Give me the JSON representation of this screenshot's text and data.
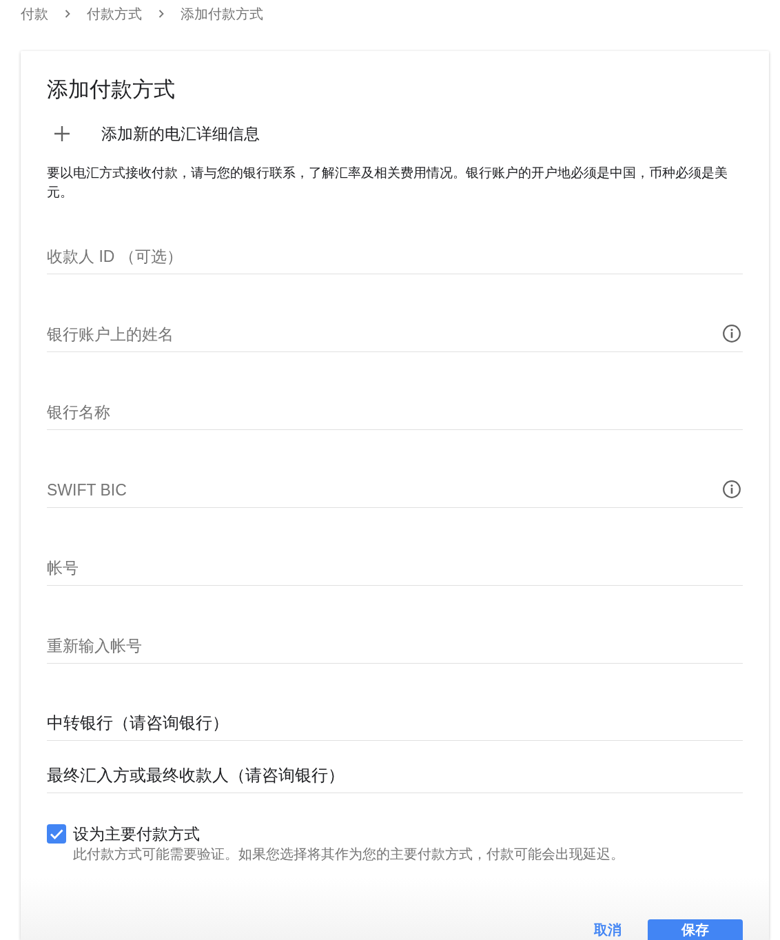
{
  "breadcrumb": [
    "付款",
    "付款方式",
    "添加付款方式"
  ],
  "card": {
    "title": "添加付款方式",
    "add_action": {
      "label": "添加新的电汇详细信息"
    },
    "description": "要以电汇方式接收付款，请与您的银行联系，了解汇率及相关费用情况。银行账户的开户地必须是中国，币种必须是美元。",
    "fields": [
      {
        "kind": "input",
        "placeholder": "收款人 ID （可选）",
        "info": false
      },
      {
        "kind": "input",
        "placeholder": "银行账户上的姓名",
        "info": true
      },
      {
        "kind": "input",
        "placeholder": "银行名称",
        "info": false
      },
      {
        "kind": "input",
        "placeholder": "SWIFT BIC",
        "info": true
      },
      {
        "kind": "input",
        "placeholder": "帐号",
        "info": false
      },
      {
        "kind": "input",
        "placeholder": "重新输入帐号",
        "info": false
      },
      {
        "kind": "section",
        "label": "中转银行（请咨询银行）"
      },
      {
        "kind": "section",
        "label": "最终汇入方或最终收款人（请咨询银行）"
      }
    ],
    "primary": {
      "label": "设为主要付款方式",
      "checked": true,
      "note": "此付款方式可能需要验证。如果您选择将其作为您的主要付款方式，付款可能会出现延迟。"
    },
    "buttons": [
      {
        "kind": "text",
        "label": "取消"
      },
      {
        "kind": "filled",
        "label": "保存"
      }
    ]
  }
}
